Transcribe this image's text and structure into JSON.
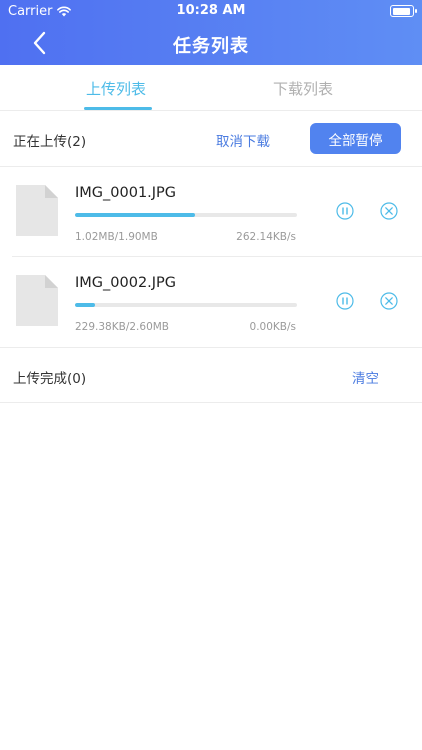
{
  "status_bar": {
    "carrier": "Carrier",
    "time": "10:28 AM"
  },
  "nav": {
    "title": "任务列表",
    "back_icon": "chevron-left-icon"
  },
  "tabs": [
    {
      "label": "上传列表",
      "active": true
    },
    {
      "label": "下载列表",
      "active": false
    }
  ],
  "uploading": {
    "title": "正在上传(2)",
    "cancel_label": "取消下载",
    "pause_all_label": "全部暂停",
    "items": [
      {
        "name": "IMG_0001.JPG",
        "size": "1.02MB/1.90MB",
        "speed": "262.14KB/s",
        "progress": 0.54
      },
      {
        "name": "IMG_0002.JPG",
        "size": "229.38KB/2.60MB",
        "speed": "0.00KB/s",
        "progress": 0.09
      }
    ]
  },
  "completed": {
    "title": "上传完成(0)",
    "clear_label": "清空"
  },
  "colors": {
    "accent": "#4dbbe8",
    "header_start": "#4f70f1",
    "header_end": "#5f8ef4",
    "button": "#5183ef",
    "link": "#4a7be0"
  }
}
